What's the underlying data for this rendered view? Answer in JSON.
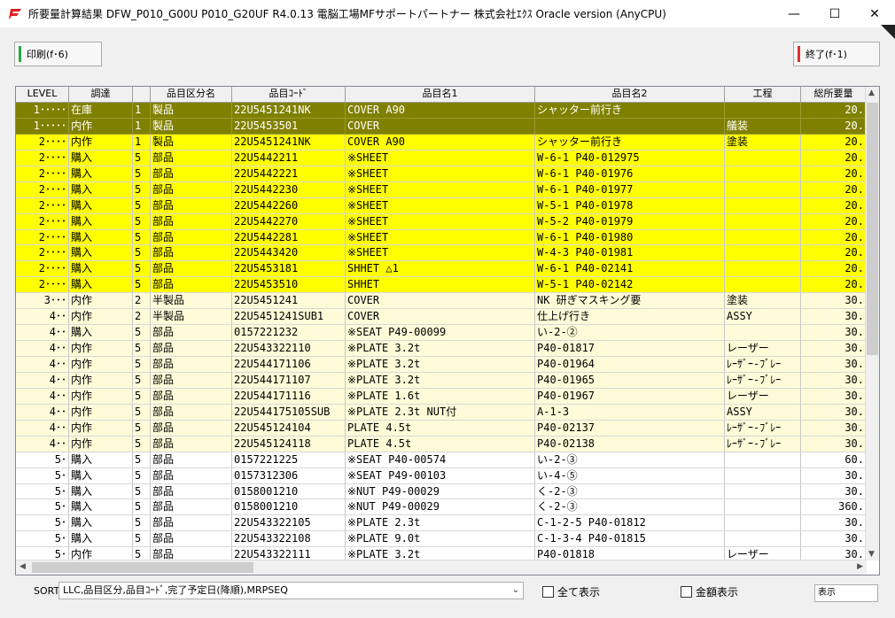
{
  "window": {
    "title": "所要量計算結果  DFW_P010_G00U  P010_G20UF  R4.0.13  電脳工場MFサポートパートナー  株式会社ｴｸｽ  Oracle version  (AnyCPU)",
    "minimize": "—",
    "maximize": "☐",
    "close": "✕",
    "accent": "#e02020"
  },
  "toolbar": {
    "print_label": "印刷(f･6)",
    "print_color": "#22aa44",
    "exit_label": "終了(f･1)",
    "exit_color": "#e03030"
  },
  "grid": {
    "columns": [
      "LEVEL",
      "調達",
      "",
      "品目区分名",
      "品目ｺｰﾄﾞ",
      "品目名1",
      "品目名2",
      "工程",
      "総所要量"
    ],
    "rows": [
      {
        "style": "olive",
        "level": "1･････",
        "proc": "在庫",
        "code": "1",
        "cat": "製品",
        "item": "22U5451241NK",
        "name1": "COVER A90",
        "name2": "シャッター前行き",
        "step": "",
        "qty": "20."
      },
      {
        "style": "olive",
        "level": "1･････",
        "proc": "内作",
        "code": "1",
        "cat": "製品",
        "item": "22U5453501",
        "name1": "COVER",
        "name2": "",
        "step": "艤装",
        "qty": "20."
      },
      {
        "style": "yellow",
        "level": "2････",
        "proc": "内作",
        "code": "1",
        "cat": "製品",
        "item": "22U5451241NK",
        "name1": "COVER A90",
        "name2": "シャッター前行き",
        "step": "塗装",
        "qty": "20."
      },
      {
        "style": "yellow",
        "level": "2････",
        "proc": "購入",
        "code": "5",
        "cat": "部品",
        "item": "22U5442211",
        "name1": "※SHEET",
        "name2": "W-6-1 P40-012975",
        "step": "",
        "qty": "20."
      },
      {
        "style": "yellow",
        "level": "2････",
        "proc": "購入",
        "code": "5",
        "cat": "部品",
        "item": "22U5442221",
        "name1": "※SHEET",
        "name2": "W-6-1 P40-01976",
        "step": "",
        "qty": "20."
      },
      {
        "style": "yellow",
        "level": "2････",
        "proc": "購入",
        "code": "5",
        "cat": "部品",
        "item": "22U5442230",
        "name1": "※SHEET",
        "name2": "W-6-1 P40-01977",
        "step": "",
        "qty": "20."
      },
      {
        "style": "yellow",
        "level": "2････",
        "proc": "購入",
        "code": "5",
        "cat": "部品",
        "item": "22U5442260",
        "name1": "※SHEET",
        "name2": "W-5-1 P40-01978",
        "step": "",
        "qty": "20."
      },
      {
        "style": "yellow",
        "level": "2････",
        "proc": "購入",
        "code": "5",
        "cat": "部品",
        "item": "22U5442270",
        "name1": "※SHEET",
        "name2": "W-5-2 P40-01979",
        "step": "",
        "qty": "20."
      },
      {
        "style": "yellow",
        "level": "2････",
        "proc": "購入",
        "code": "5",
        "cat": "部品",
        "item": "22U5442281",
        "name1": "※SHEET",
        "name2": "W-6-1 P40-01980",
        "step": "",
        "qty": "20."
      },
      {
        "style": "yellow",
        "level": "2････",
        "proc": "購入",
        "code": "5",
        "cat": "部品",
        "item": "22U5443420",
        "name1": "※SHEET",
        "name2": "W-4-3 P40-01981",
        "step": "",
        "qty": "20."
      },
      {
        "style": "yellow",
        "level": "2････",
        "proc": "購入",
        "code": "5",
        "cat": "部品",
        "item": "22U5453181",
        "name1": "SHHET △1",
        "name2": "W-6-1 P40-02141",
        "step": "",
        "qty": "20."
      },
      {
        "style": "yellow",
        "level": "2････",
        "proc": "購入",
        "code": "5",
        "cat": "部品",
        "item": "22U5453510",
        "name1": "SHHET",
        "name2": "W-5-1 P40-02142",
        "step": "",
        "qty": "20."
      },
      {
        "style": "cream",
        "level": "3･･･",
        "proc": "内作",
        "code": "2",
        "cat": "半製品",
        "item": "22U5451241",
        "name1": "COVER",
        "name2": "NK 研ぎマスキング要",
        "step": "塗装",
        "qty": "30."
      },
      {
        "style": "cream",
        "level": "4･･",
        "proc": "内作",
        "code": "2",
        "cat": "半製品",
        "item": "22U5451241SUB1",
        "name1": "COVER",
        "name2": "仕上げ行き",
        "step": "ASSY",
        "qty": "30."
      },
      {
        "style": "cream",
        "level": "4･･",
        "proc": "購入",
        "code": "5",
        "cat": "部品",
        "item": "0157221232",
        "name1": "※SEAT P49-00099",
        "name2": "い-2-②",
        "step": "",
        "qty": "30."
      },
      {
        "style": "cream",
        "level": "4･･",
        "proc": "内作",
        "code": "5",
        "cat": "部品",
        "item": "22U543322110",
        "name1": "※PLATE 3.2t",
        "name2": "P40-01817",
        "step": "レーザー",
        "qty": "30."
      },
      {
        "style": "cream",
        "level": "4･･",
        "proc": "内作",
        "code": "5",
        "cat": "部品",
        "item": "22U544171106",
        "name1": "※PLATE 3.2t",
        "name2": "P40-01964",
        "step": "ﾚｰｻﾞｰ-ﾌﾞﾚｰ",
        "qty": "30."
      },
      {
        "style": "cream",
        "level": "4･･",
        "proc": "内作",
        "code": "5",
        "cat": "部品",
        "item": "22U544171107",
        "name1": "※PLATE 3.2t",
        "name2": "P40-01965",
        "step": "ﾚｰｻﾞｰ-ﾌﾞﾚｰ",
        "qty": "30."
      },
      {
        "style": "cream",
        "level": "4･･",
        "proc": "内作",
        "code": "5",
        "cat": "部品",
        "item": "22U544171116",
        "name1": "※PLATE 1.6t",
        "name2": "P40-01967",
        "step": "レーザー",
        "qty": "30."
      },
      {
        "style": "cream",
        "level": "4･･",
        "proc": "内作",
        "code": "5",
        "cat": "部品",
        "item": "22U544175105SUB",
        "name1": "※PLATE 2.3t NUT付",
        "name2": "A-1-3",
        "step": "ASSY",
        "qty": "30."
      },
      {
        "style": "cream",
        "level": "4･･",
        "proc": "内作",
        "code": "5",
        "cat": "部品",
        "item": "22U545124104",
        "name1": "PLATE 4.5t",
        "name2": "P40-02137",
        "step": "ﾚｰｻﾞｰ-ﾌﾞﾚｰ",
        "qty": "30."
      },
      {
        "style": "cream",
        "level": "4･･",
        "proc": "内作",
        "code": "5",
        "cat": "部品",
        "item": "22U545124118",
        "name1": "PLATE 4.5t",
        "name2": "P40-02138",
        "step": "ﾚｰｻﾞｰ-ﾌﾞﾚｰ",
        "qty": "30."
      },
      {
        "style": "white",
        "level": "5･",
        "proc": "購入",
        "code": "5",
        "cat": "部品",
        "item": "0157221225",
        "name1": "※SEAT P40-00574",
        "name2": "い-2-③",
        "step": "",
        "qty": "60."
      },
      {
        "style": "white",
        "level": "5･",
        "proc": "購入",
        "code": "5",
        "cat": "部品",
        "item": "0157312306",
        "name1": "※SEAT P49-00103",
        "name2": "い-4-⑤",
        "step": "",
        "qty": "30."
      },
      {
        "style": "white",
        "level": "5･",
        "proc": "購入",
        "code": "5",
        "cat": "部品",
        "item": "0158001210",
        "name1": "※NUT P49-00029",
        "name2": "く-2-③",
        "step": "",
        "qty": "30."
      },
      {
        "style": "white",
        "level": "5･",
        "proc": "購入",
        "code": "5",
        "cat": "部品",
        "item": "0158001210",
        "name1": "※NUT P49-00029",
        "name2": "く-2-③",
        "step": "",
        "qty": "360."
      },
      {
        "style": "white",
        "level": "5･",
        "proc": "購入",
        "code": "5",
        "cat": "部品",
        "item": "22U543322105",
        "name1": "※PLATE 2.3t",
        "name2": "C-1-2-5 P40-01812",
        "step": "",
        "qty": "30."
      },
      {
        "style": "white",
        "level": "5･",
        "proc": "購入",
        "code": "5",
        "cat": "部品",
        "item": "22U543322108",
        "name1": "※PLATE 9.0t",
        "name2": "C-1-3-4 P40-01815",
        "step": "",
        "qty": "30."
      },
      {
        "style": "white",
        "level": "5･",
        "proc": "内作",
        "code": "5",
        "cat": "部品",
        "item": "22U543322111",
        "name1": "※PLATE 3.2t",
        "name2": "P40-01818",
        "step": "レーザー",
        "qty": "30."
      }
    ]
  },
  "footer": {
    "sort_label": "SORT",
    "sort_value": "LLC,品目区分,品目ｺｰﾄﾞ,完了予定日(降順),MRPSEQ",
    "show_all_label": "全て表示",
    "show_amount_label": "金額表示",
    "display_value": "表示"
  }
}
